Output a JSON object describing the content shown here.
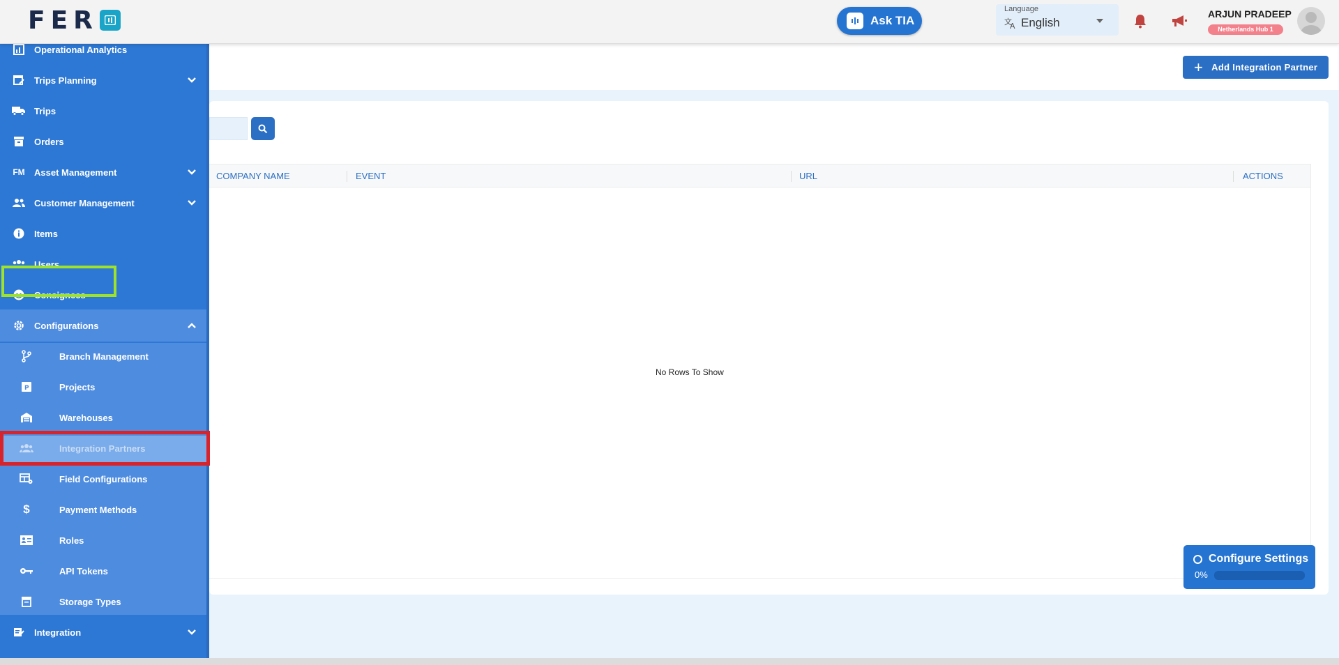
{
  "header": {
    "logo_text": "FER",
    "ask_tia_label": "Ask TIA",
    "language_label": "Language",
    "language_value": "English",
    "user_name": "ARJUN PRADEEP",
    "user_hub": "Netherlands Hub 1"
  },
  "sidebar": {
    "items": [
      {
        "label": "Operational Analytics",
        "icon": "analytics-icon"
      },
      {
        "label": "Trips Planning",
        "icon": "calendar-edit-icon"
      },
      {
        "label": "Trips",
        "icon": "truck-icon"
      },
      {
        "label": "Orders",
        "icon": "archive-icon"
      },
      {
        "label": "Asset Management",
        "icon": "fm-icon"
      },
      {
        "label": "Customer Management",
        "icon": "people-icon"
      },
      {
        "label": "Items",
        "icon": "info-icon"
      },
      {
        "label": "Users",
        "icon": "group-icon"
      },
      {
        "label": "Consignees",
        "icon": "face-icon"
      },
      {
        "label": "Configurations",
        "icon": "gear-icon"
      },
      {
        "label": "Integration",
        "icon": "edit-note-icon"
      }
    ],
    "sub_items": [
      {
        "label": "Branch Management",
        "icon": "branch-icon"
      },
      {
        "label": "Projects",
        "icon": "projects-icon"
      },
      {
        "label": "Warehouses",
        "icon": "warehouse-icon"
      },
      {
        "label": "Integration Partners",
        "icon": "partners-icon"
      },
      {
        "label": "Field Configurations",
        "icon": "table-settings-icon"
      },
      {
        "label": "Payment Methods",
        "icon": "dollar-icon"
      },
      {
        "label": "Roles",
        "icon": "id-card-icon"
      },
      {
        "label": "API Tokens",
        "icon": "key-icon"
      },
      {
        "label": "Storage Types",
        "icon": "storage-icon"
      }
    ],
    "active_item": "Configurations",
    "active_sub_item": "Integration Partners"
  },
  "main": {
    "add_button_label": "Add Integration Partner",
    "columns": [
      "COMPANY NAME",
      "EVENT",
      "URL",
      "ACTIONS"
    ],
    "empty_message": "No Rows To Show"
  },
  "configure_panel": {
    "title": "Configure Settings",
    "progress_text": "0%",
    "progress": 0
  },
  "colors": {
    "sidebar": "#2d78d4",
    "primary": "#2b6fc5",
    "highlight_green": "#9ee329",
    "highlight_red": "#d8232a"
  }
}
